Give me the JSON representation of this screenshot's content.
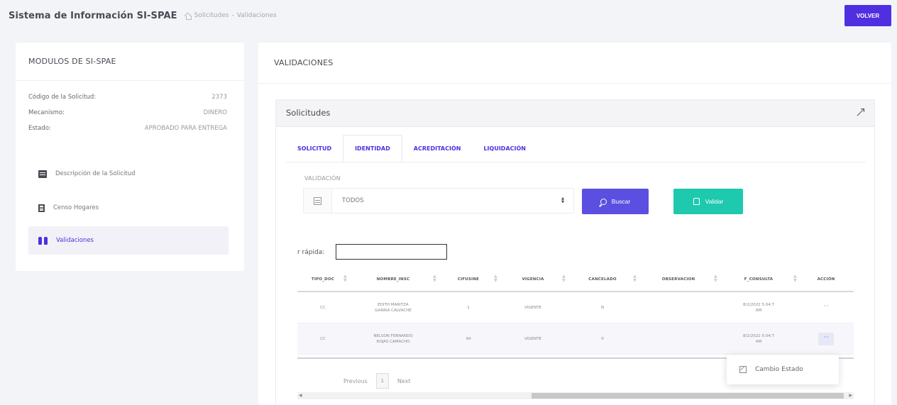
{
  "header": {
    "title": "Sistema de Información SI-SPAE",
    "breadcrumb": [
      "Solicitudes",
      "-",
      "Validaciones"
    ],
    "back_button": "VOLVER"
  },
  "left_panel": {
    "title": "MODULOS DE SI-SPAE",
    "info": [
      {
        "label": "Código de la Solicitud:",
        "value": "2373"
      },
      {
        "label": "Mecanismo:",
        "value": "DINERO"
      },
      {
        "label": "Estado:",
        "value": "APROBADO PARA ENTREGA"
      }
    ],
    "menu": [
      {
        "label": "Descripción de la Solicitud",
        "icon": "calendar-icon"
      },
      {
        "label": "Censo Hogares",
        "icon": "document-icon"
      },
      {
        "label": "Validaciones",
        "icon": "binoculars-icon"
      }
    ]
  },
  "main": {
    "title": "VALIDACIONES",
    "card_title": "Solicitudes",
    "tabs": [
      "SOLICITUD",
      "IDENTIDAD",
      "ACREDITACIÓN",
      "LIQUIDACIÓN"
    ],
    "active_tab": "IDENTIDAD",
    "filter": {
      "label": "VALIDACIÓN",
      "selected": "TODOS"
    },
    "buttons": {
      "buscar": "Buscar",
      "validar": "Validar"
    },
    "quick_search_label": "r rápida:",
    "table": {
      "columns": [
        "TIPO_DOC",
        "NOMBRE_INSC",
        "CIFUSINE",
        "VIGENCIA",
        "CANCELADO",
        "OBSERVACION",
        "F_CONSULTA",
        "ACCIÓN"
      ],
      "rows": [
        [
          "CC",
          "EDITH MARITZA\nGARRIA CALVACHE",
          "1",
          "VIGENTE",
          "N",
          "",
          "8/2/2022 5:04:T\nAM",
          "···"
        ],
        [
          "CC",
          "NELSON FERNANDO\nROJAS CAMACHO",
          "94",
          "VIGENTE",
          "0",
          "",
          "8/2/2022 5:04:T\nAM",
          "···"
        ]
      ]
    },
    "pagination": {
      "previous": "Previous",
      "page": "1",
      "next": "Next"
    },
    "dropdown_item": "Cambio Estado"
  },
  "colors": {
    "primary": "#4f2fe0",
    "buscar": "#5a4fe0",
    "validar": "#1ec9ae"
  }
}
